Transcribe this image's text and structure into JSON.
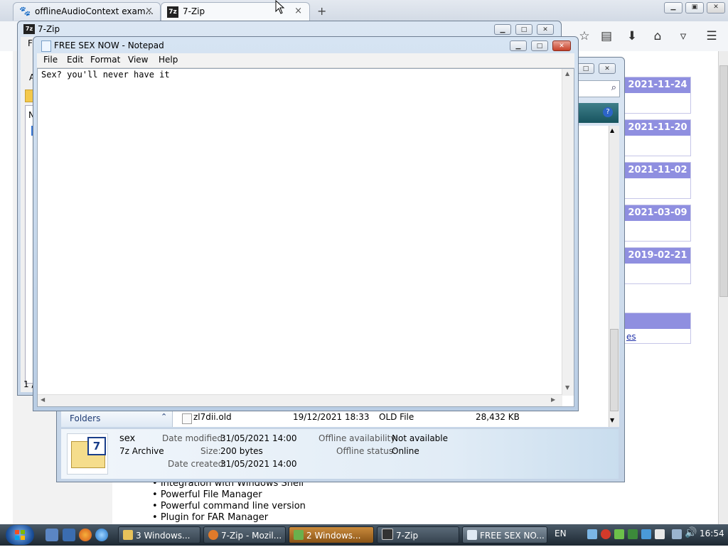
{
  "firefox": {
    "tabs": [
      {
        "label": "offlineAudioContext exam...",
        "icon": "paw-icon"
      },
      {
        "label": "7-Zip",
        "icon": "7z-icon"
      }
    ],
    "new_tab": "+",
    "close": "×"
  },
  "page": {
    "dates": [
      "2021-11-24",
      "2021-11-20",
      "2021-11-02",
      "2021-03-09",
      "2019-02-21"
    ],
    "link_fragment": "es",
    "bullets": [
      "Integration with Windows Shell",
      "Powerful File Manager",
      "Powerful command line version",
      "Plugin for FAR Manager"
    ]
  },
  "sevenzip_fm": {
    "title": "7-Zip",
    "menu_fragment": "Fi",
    "left_fragments": [
      "A",
      "N"
    ],
    "status_fragment": "1 /"
  },
  "explorer": {
    "folders_label": "Folders",
    "row": {
      "name": "zl7dii.old",
      "date": "19/12/2021 18:33",
      "type": "OLD File",
      "size": "28,432 KB"
    },
    "details": {
      "name": "sex",
      "type": "7z Archive",
      "date_modified_label": "Date modified:",
      "date_modified": "31/05/2021 14:00",
      "size_label": "Size:",
      "size": "200 bytes",
      "date_created_label": "Date created:",
      "date_created": "31/05/2021 14:00",
      "offline_availability_label": "Offline availability:",
      "offline_availability": "Not available",
      "offline_status_label": "Offline status:",
      "offline_status": "Online"
    }
  },
  "notepad": {
    "title": "FREE SEX NOW - Notepad",
    "menu": [
      "File",
      "Edit",
      "Format",
      "View",
      "Help"
    ],
    "content": "Sex? you'll never have it"
  },
  "taskbar": {
    "buttons": [
      {
        "label": "3 Windows...",
        "color": "#e8c25a"
      },
      {
        "label": "7-Zip - Mozil...",
        "color": "#e07a2a"
      },
      {
        "label": "2 Windows...",
        "color": "#6ab04c"
      },
      {
        "label": "7-Zip",
        "color": "#333333"
      },
      {
        "label": "FREE SEX NO...",
        "color": "#dfe9f3"
      }
    ],
    "language": "EN",
    "clock": "16:54"
  },
  "colors": {
    "date_header": "#8f8fe0",
    "titlebar_active": "#c4d4e7",
    "close_red": "#c6412a"
  }
}
